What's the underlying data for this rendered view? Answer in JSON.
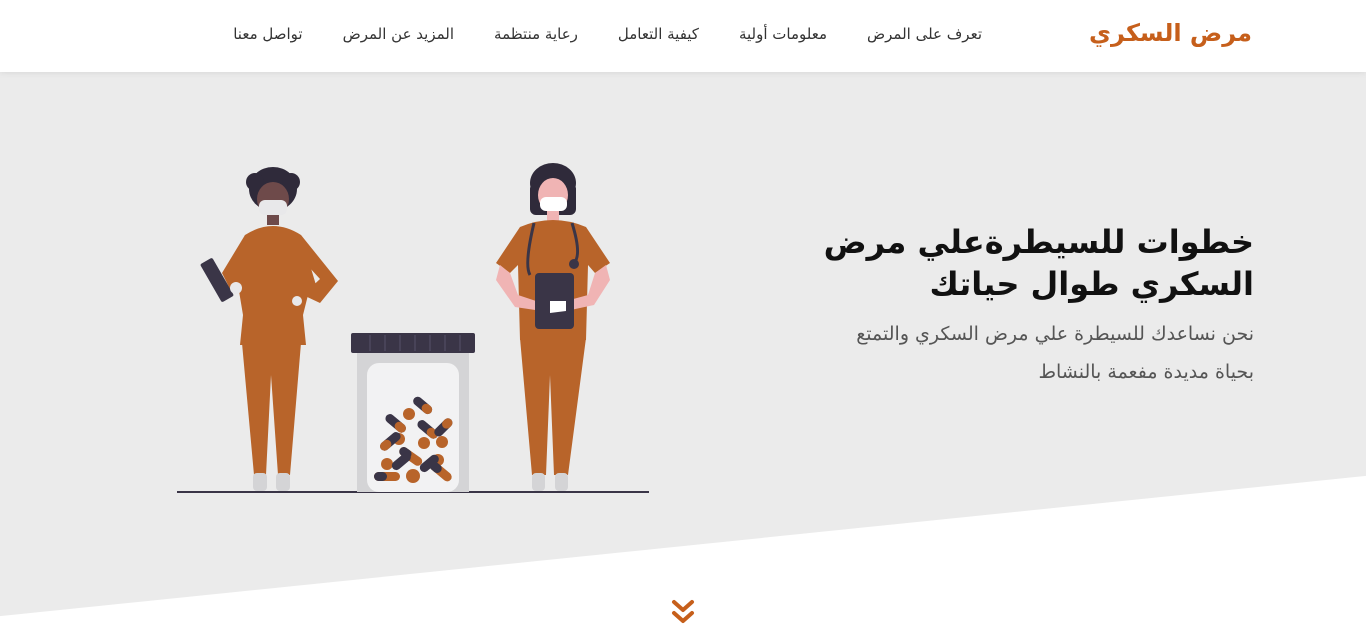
{
  "brand": {
    "title": "مرض السكري",
    "color": "#c65f1b"
  },
  "nav": {
    "items": [
      {
        "label": "تعرف على المرض"
      },
      {
        "label": "معلومات أولية"
      },
      {
        "label": "كيفية التعامل"
      },
      {
        "label": "رعاية منتظمة"
      },
      {
        "label": "المزيد عن المرض"
      },
      {
        "label": "تواصل معنا"
      }
    ]
  },
  "hero": {
    "title_line1": "خطوات للسيطرةعلي مرض",
    "title_line2": "السكري طوال حياتك",
    "subtitle_line1": "نحن نساعدك للسيطرة علي مرض السكري والتمتع",
    "subtitle_line2": "بحياة مديدة مفعمة بالنشاط"
  },
  "illustration": {
    "icon": "doctors-and-pills-illustration",
    "accent": "#b8642a",
    "dark": "#3a3547"
  },
  "scroll": {
    "icon": "double-chevron-down-icon",
    "color": "#c65f1b"
  }
}
